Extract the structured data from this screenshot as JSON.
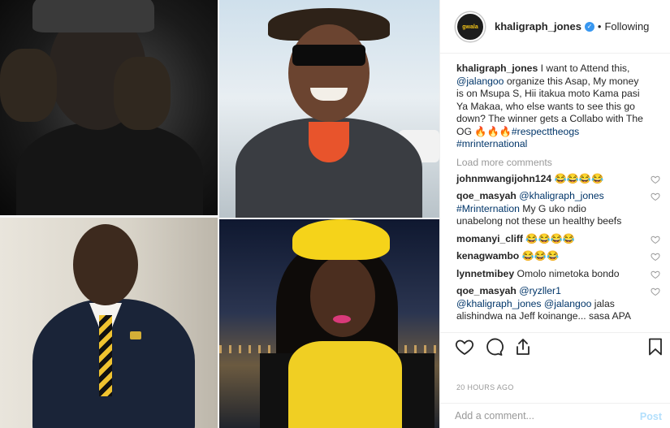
{
  "post": {
    "username": "khaligraph_jones",
    "avatar_text": "gwala",
    "follow_status": "Following",
    "separator": "•",
    "verified_mark": "✓"
  },
  "caption": {
    "username": "khaligraph_jones",
    "part1": " I want to Attend this, ",
    "mention1": "@jalangoo",
    "part2": " organize this Asap, My money is on Msupa S, Hii itakua moto Kama pasi Ya Makaa, who else wants to see this go down? The winner gets a Collabo with The OG 🔥🔥🔥",
    "hashtag1": "#respecttheogs",
    "hashtag2": "#mrinternational"
  },
  "load_more": "Load more comments",
  "comments": [
    {
      "user": "johnmwangijohn124",
      "text": " 😂😂😂😂",
      "mention": "",
      "rest": ""
    },
    {
      "user": "qoe_masyah",
      "text": " ",
      "mention": "@khaligraph_jones",
      "mention2": "#Mrinternation",
      "rest": " My G uko ndio unabelong not these un healthy beefs"
    },
    {
      "user": "momanyi_cliff",
      "text": " 😂😂😂😂",
      "mention": "",
      "rest": ""
    },
    {
      "user": "kenagwambo",
      "text": " 😂😂😂",
      "mention": "",
      "rest": ""
    },
    {
      "user": "lynnetmibey",
      "text": " Omolo nimetoka bondo",
      "mention": "",
      "rest": ""
    },
    {
      "user": "qoe_masyah",
      "text": " ",
      "mention": "@ryzller1",
      "mention2": "@khaligraph_jones",
      "mention3": "@jalangoo",
      "rest": " jalas alishindwa na Jeff koinange... sasa APA"
    }
  ],
  "timestamp": "20 HOURS AGO",
  "add_comment_placeholder": "Add a comment...",
  "post_button": "Post",
  "icons": [
    "heart-icon",
    "comment-icon",
    "share-icon",
    "bookmark-icon"
  ],
  "colors": {
    "link": "#003569",
    "verified": "#3897f0",
    "muted": "#999999"
  }
}
